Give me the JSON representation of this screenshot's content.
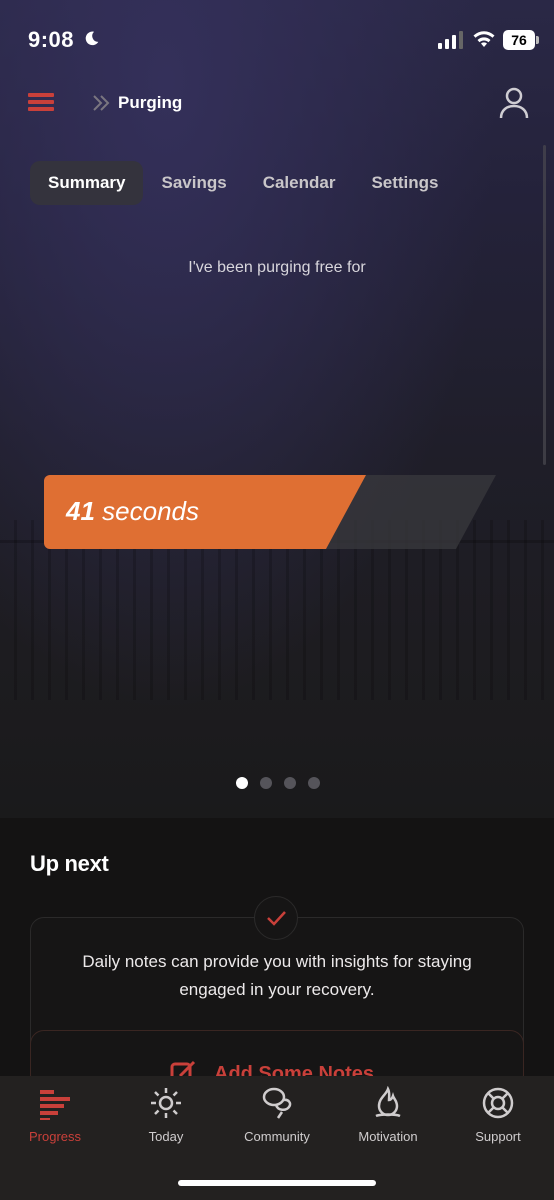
{
  "status_bar": {
    "time": "9:08",
    "battery": "76"
  },
  "header": {
    "title": "Purging",
    "menu_icon": "hamburger-menu-icon",
    "profile_icon": "user-icon"
  },
  "tabs": [
    {
      "label": "Summary",
      "active": true
    },
    {
      "label": "Savings",
      "active": false
    },
    {
      "label": "Calendar",
      "active": false
    },
    {
      "label": "Settings",
      "active": false
    }
  ],
  "hero": {
    "free_label": "I've been purging free for",
    "counter_value": "41",
    "counter_unit": "seconds",
    "pager": {
      "pages": 4,
      "current": 1
    }
  },
  "up_next": {
    "heading": "Up next",
    "card_text": "Daily notes can provide you with insights for staying engaged in your recovery.",
    "action_label": "Add Some Notes"
  },
  "tab_bar": [
    {
      "label": "Progress",
      "icon": "progress-bars-icon",
      "active": true
    },
    {
      "label": "Today",
      "icon": "sun-icon",
      "active": false
    },
    {
      "label": "Community",
      "icon": "chat-bubbles-icon",
      "active": false
    },
    {
      "label": "Motivation",
      "icon": "flame-icon",
      "active": false
    },
    {
      "label": "Support",
      "icon": "lifebuoy-icon",
      "active": false
    }
  ],
  "colors": {
    "accent": "#c9403a",
    "counter": "#df6f33"
  }
}
